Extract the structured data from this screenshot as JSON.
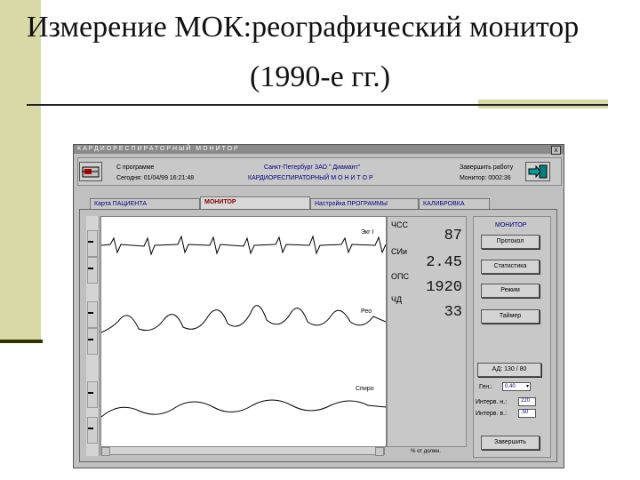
{
  "slide": {
    "title_line1": "Измерение МОК:реографический монитор",
    "title_line2": "(1990-е гг.)"
  },
  "window": {
    "title": "КАРДИОРЕСПИРАТОРНЫЙ МОНИТОР",
    "close": "x",
    "header": {
      "left_line1": "С программе",
      "left_line2": "Сегодня: 01/04/99  16:21:48",
      "center_line1": "Санкт-Петербург ЗАО \" Диамант\"",
      "center_line2": "КАРДИОРЕСПИРАТОРНЫЙ  М О Н И Т О Р",
      "right_line1": "Завершить работу",
      "right_line2": "Монитор:  0002:36"
    },
    "tabs": [
      {
        "label": "Карта ПАЦИЕНТА"
      },
      {
        "label": "МОНИТОР"
      },
      {
        "label": "Настройка ПРОГРАММЫ"
      },
      {
        "label": "КАЛИБРОВКА"
      }
    ],
    "traces": {
      "ecg_label": "Экг I",
      "reo_label": "Рео",
      "spiro_label": "Спиро"
    },
    "readouts": [
      {
        "label": "ЧСС",
        "value": "87"
      },
      {
        "label": "СИи",
        "value": "2.45"
      },
      {
        "label": "ОПС",
        "value": "1920"
      },
      {
        "label": "ЧД",
        "value": "33"
      }
    ],
    "readout_footer": "% от должн.",
    "side": {
      "header": "МОНИТОР",
      "buttons": [
        "Протокол",
        "Статистика",
        "Режим",
        "Таймер"
      ],
      "bp": "АД:  130 / 80",
      "gain_label": "Ген.:",
      "gain_value": "0.40",
      "interval_n_label": "Интерв. н.:",
      "interval_n_value": "220",
      "interval_v_label": "Интерв. в.:",
      "interval_v_value": ".50",
      "finish": "Завершить"
    }
  }
}
